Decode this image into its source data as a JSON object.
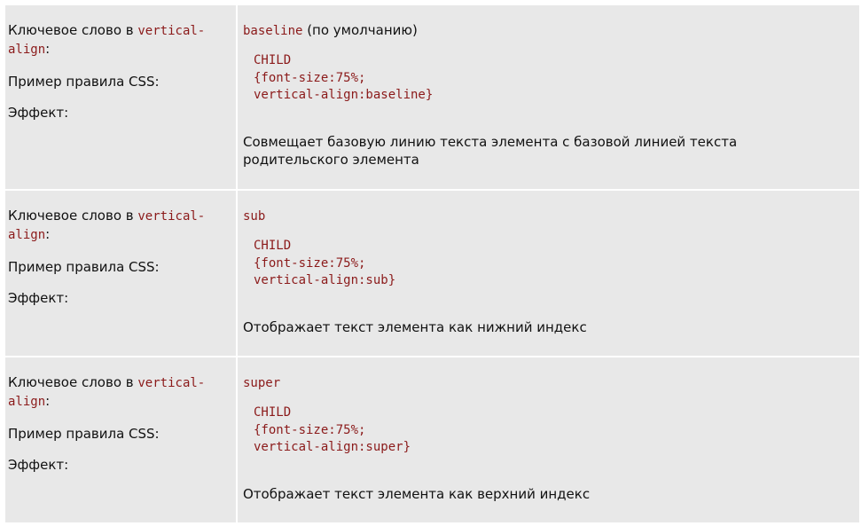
{
  "labels": {
    "keyword_prefix": "Ключевое слово в ",
    "keyword_prop_1": "vertical-",
    "keyword_prop_2": "align",
    "keyword_suffix": ":",
    "example": "Пример правила CSS:",
    "effect": "Эффект:"
  },
  "rows": [
    {
      "keyword": "baseline",
      "keyword_note": " (по умолчанию)",
      "code": [
        "CHILD",
        "{font-size:75%;",
        "vertical-align:baseline}"
      ],
      "effect": "Совмещает базовую линию текста элемента с базовой линией текста родительского элемента"
    },
    {
      "keyword": "sub",
      "keyword_note": "",
      "code": [
        "CHILD",
        "{font-size:75%;",
        "vertical-align:sub}"
      ],
      "effect": "Отображает текст элемента как нижний индекс"
    },
    {
      "keyword": "super",
      "keyword_note": "",
      "code": [
        "CHILD",
        "{font-size:75%;",
        "vertical-align:super}"
      ],
      "effect": "Отображает текст элемента как верхний индекс"
    }
  ]
}
